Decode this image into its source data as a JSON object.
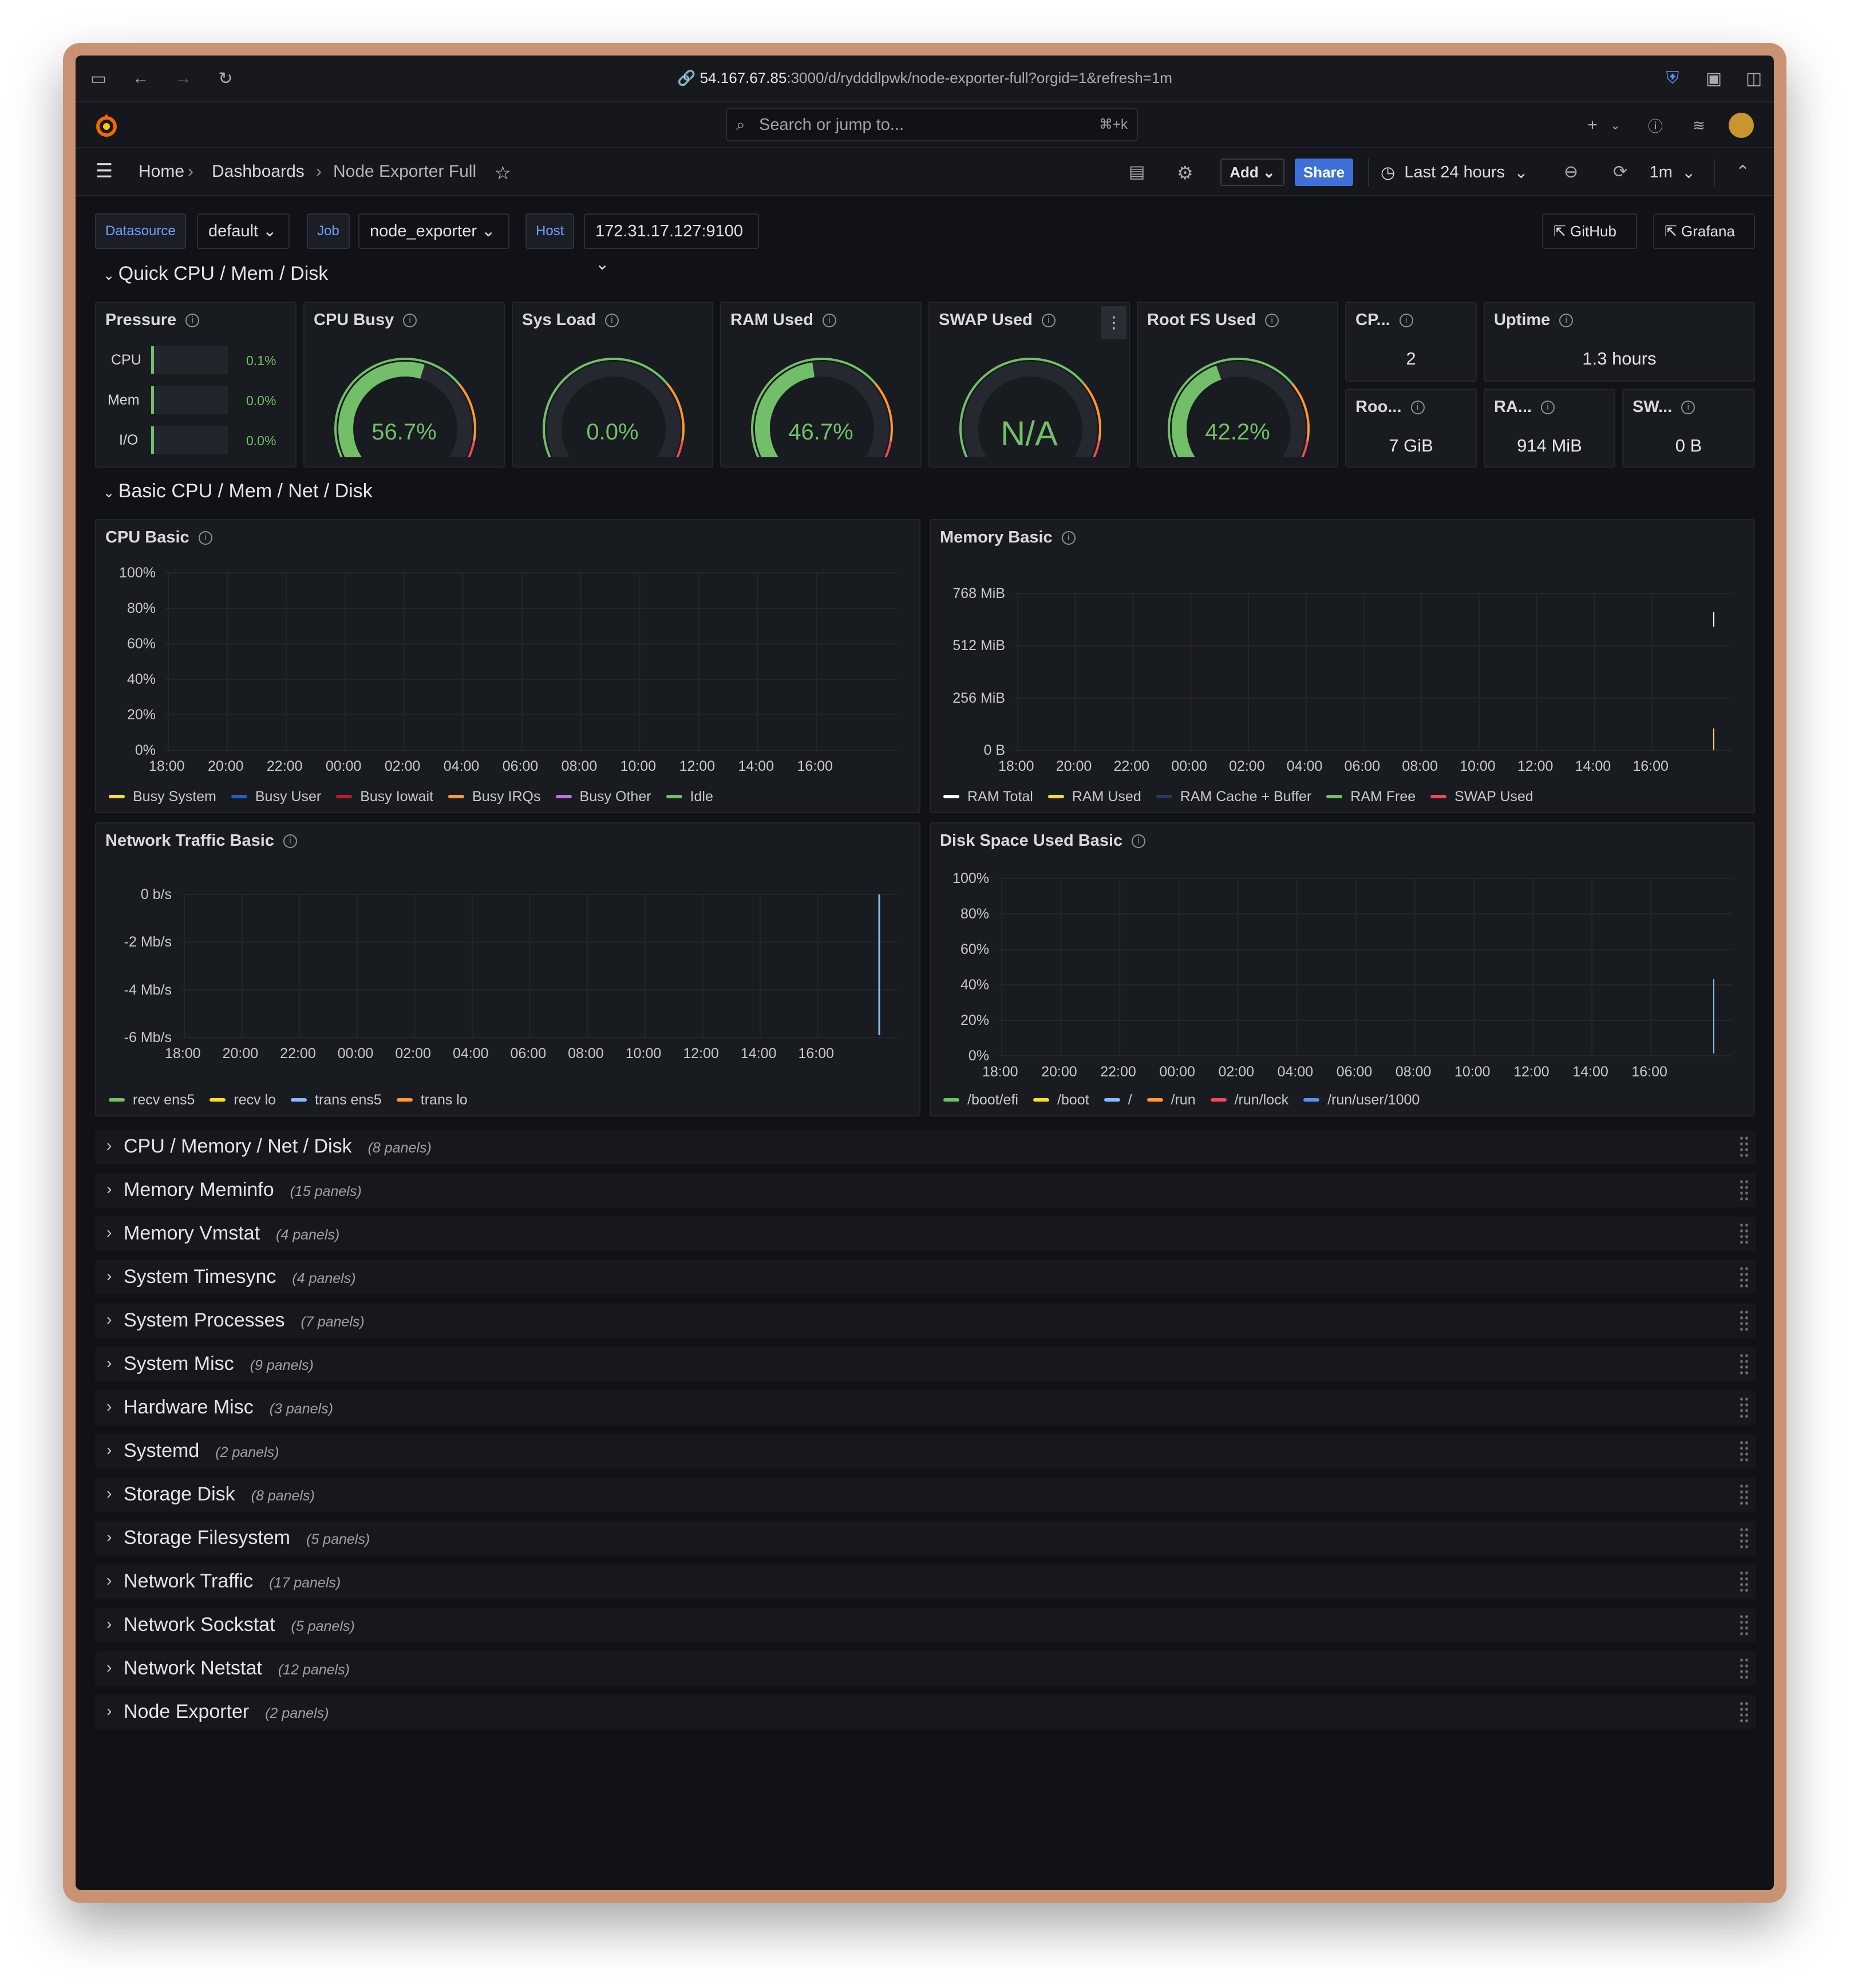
{
  "browser": {
    "url_host": "54.167.67.85",
    "url_rest": ":3000/d/rydddlpwk/node-exporter-full?orgid=1&refresh=1m"
  },
  "topbar": {
    "search_placeholder": "Search or jump to...",
    "search_shortcut": "⌘+k"
  },
  "breadcrumb": {
    "home": "Home",
    "dashboards": "Dashboards",
    "current": "Node Exporter Full"
  },
  "toolbar": {
    "add": "Add",
    "share": "Share",
    "time_range": "Last 24 hours",
    "refresh_interval": "1m"
  },
  "variables": {
    "datasource_label": "Datasource",
    "datasource_value": "default",
    "job_label": "Job",
    "job_value": "node_exporter",
    "host_label": "Host",
    "host_value": "172.31.17.127:9100",
    "link_github": "GitHub",
    "link_grafana": "Grafana"
  },
  "rows": {
    "quick": "Quick CPU / Mem / Disk",
    "basic": "Basic CPU / Mem / Net / Disk"
  },
  "quick_panels": {
    "pressure": {
      "title": "Pressure",
      "items": [
        {
          "label": "CPU",
          "value": "0.1%"
        },
        {
          "label": "Mem",
          "value": "0.0%"
        },
        {
          "label": "I/O",
          "value": "0.0%"
        }
      ]
    },
    "cpu_busy": {
      "title": "CPU Busy",
      "value": "56.7%",
      "fraction": 0.567
    },
    "sys_load": {
      "title": "Sys Load",
      "value": "0.0%",
      "fraction": 0.0
    },
    "ram_used": {
      "title": "RAM Used",
      "value": "46.7%",
      "fraction": 0.467
    },
    "swap_used": {
      "title": "SWAP Used",
      "value": "N/A",
      "fraction": 0.0
    },
    "root_fs_used": {
      "title": "Root FS Used",
      "value": "42.2%",
      "fraction": 0.422
    },
    "cpu_cores": {
      "title": "CP...",
      "value": "2"
    },
    "uptime": {
      "title": "Uptime",
      "value": "1.3 hours"
    },
    "rootfs_total": {
      "title": "Roo...",
      "value": "7 GiB"
    },
    "ram_total": {
      "title": "RA...",
      "value": "914 MiB"
    },
    "swap_total": {
      "title": "SW...",
      "value": "0 B"
    }
  },
  "colors": {
    "green": "#73bf69",
    "yellow": "#fade2a",
    "blue": "#5794f2",
    "red": "#f2495c",
    "orange": "#ff9830",
    "purple": "#b877d9",
    "darkblue": "#1f60c4",
    "darkred": "#c4162a",
    "white": "#ffffff",
    "navy": "#223d63"
  },
  "time_ticks": [
    "18:00",
    "20:00",
    "22:00",
    "00:00",
    "02:00",
    "04:00",
    "06:00",
    "08:00",
    "10:00",
    "12:00",
    "14:00",
    "16:00"
  ],
  "charts": {
    "cpu_basic": {
      "title": "CPU Basic",
      "y_ticks": [
        "100%",
        "80%",
        "60%",
        "40%",
        "20%",
        "0%"
      ],
      "legend": [
        {
          "name": "Busy System",
          "color": "#fade2a"
        },
        {
          "name": "Busy User",
          "color": "#1f60c4"
        },
        {
          "name": "Busy Iowait",
          "color": "#c4162a"
        },
        {
          "name": "Busy IRQs",
          "color": "#ff9830"
        },
        {
          "name": "Busy Other",
          "color": "#b877d9"
        },
        {
          "name": "Idle",
          "color": "#73bf69"
        }
      ]
    },
    "memory_basic": {
      "title": "Memory Basic",
      "y_ticks": [
        "768 MiB",
        "512 MiB",
        "256 MiB",
        "0 B"
      ],
      "legend": [
        {
          "name": "RAM Total",
          "color": "#ffffff"
        },
        {
          "name": "RAM Used",
          "color": "#fade2a"
        },
        {
          "name": "RAM Cache + Buffer",
          "color": "#223d63"
        },
        {
          "name": "RAM Free",
          "color": "#73bf69"
        },
        {
          "name": "SWAP Used",
          "color": "#f2495c"
        }
      ]
    },
    "network_basic": {
      "title": "Network Traffic Basic",
      "y_ticks": [
        "0 b/s",
        "-2 Mb/s",
        "-4 Mb/s",
        "-6 Mb/s"
      ],
      "legend": [
        {
          "name": "recv ens5",
          "color": "#73bf69"
        },
        {
          "name": "recv lo",
          "color": "#fade2a"
        },
        {
          "name": "trans ens5",
          "color": "#8ab8ff"
        },
        {
          "name": "trans lo",
          "color": "#ff9830"
        }
      ]
    },
    "disk_basic": {
      "title": "Disk Space Used Basic",
      "y_ticks": [
        "100%",
        "80%",
        "60%",
        "40%",
        "20%",
        "0%"
      ],
      "legend": [
        {
          "name": "/boot/efi",
          "color": "#73bf69"
        },
        {
          "name": "/boot",
          "color": "#fade2a"
        },
        {
          "name": "/",
          "color": "#8ab8ff"
        },
        {
          "name": "/run",
          "color": "#ff9830"
        },
        {
          "name": "/run/lock",
          "color": "#f2495c"
        },
        {
          "name": "/run/user/1000",
          "color": "#5794f2"
        }
      ]
    }
  },
  "collapsed_rows": [
    {
      "title": "CPU / Memory / Net / Disk",
      "count": "(8 panels)"
    },
    {
      "title": "Memory Meminfo",
      "count": "(15 panels)"
    },
    {
      "title": "Memory Vmstat",
      "count": "(4 panels)"
    },
    {
      "title": "System Timesync",
      "count": "(4 panels)"
    },
    {
      "title": "System Processes",
      "count": "(7 panels)"
    },
    {
      "title": "System Misc",
      "count": "(9 panels)"
    },
    {
      "title": "Hardware Misc",
      "count": "(3 panels)"
    },
    {
      "title": "Systemd",
      "count": "(2 panels)"
    },
    {
      "title": "Storage Disk",
      "count": "(8 panels)"
    },
    {
      "title": "Storage Filesystem",
      "count": "(5 panels)"
    },
    {
      "title": "Network Traffic",
      "count": "(17 panels)"
    },
    {
      "title": "Network Sockstat",
      "count": "(5 panels)"
    },
    {
      "title": "Network Netstat",
      "count": "(12 panels)"
    },
    {
      "title": "Node Exporter",
      "count": "(2 panels)"
    }
  ]
}
